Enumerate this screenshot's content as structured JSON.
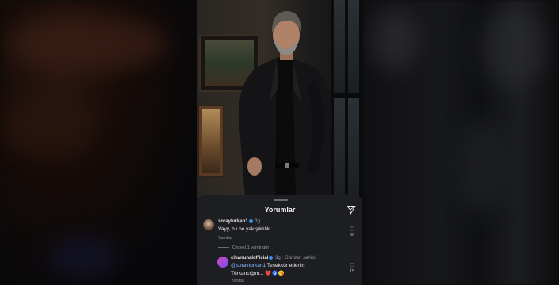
{
  "sheet": {
    "title": "Yorumlar",
    "share_icon": "paper-plane-icon"
  },
  "comments": [
    {
      "user": "sorayturkan1",
      "time": "3g",
      "verified": true,
      "text": "Vayy, bu ne yakışıklılık...",
      "reply_label": "Yanıtla",
      "likes": "66"
    }
  ],
  "view_previous": "Önceki 1 yanıtı gör",
  "reply": {
    "user": "cihanunalofficial",
    "time": "3g",
    "author_tag": "Gönderi sahibi",
    "mention": "@sorayturkan1",
    "text_line1": "Teşekkür ederim",
    "text_line2": "Türkancığım...",
    "emojis": "❤️🧿😘",
    "reply_label": "Yanıtla",
    "likes": "15"
  },
  "colors": {
    "sheet_bg": "#1d1e21",
    "verified": "#3b8ff0",
    "mention": "#8ab4ff"
  }
}
